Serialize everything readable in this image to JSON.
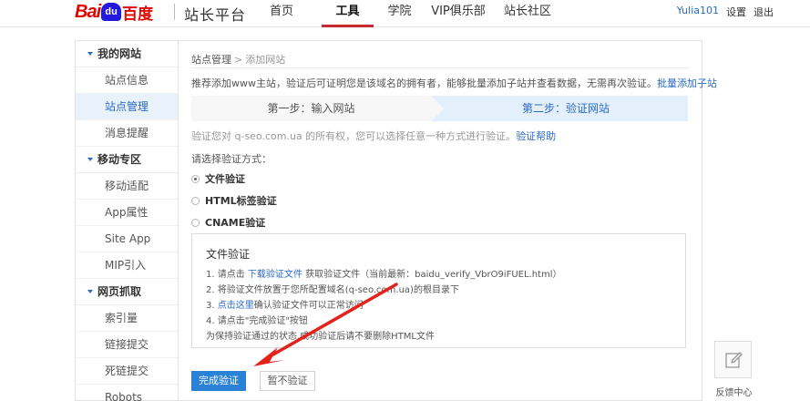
{
  "header": {
    "logo": {
      "part1": "Bai",
      "paw": "du",
      "part2": "百度"
    },
    "site_name": "站长平台",
    "nav": [
      "首页",
      "工具",
      "学院",
      "VIP俱乐部",
      "站长社区"
    ],
    "active_nav": "工具",
    "username": "Yulia101",
    "settings": "设置",
    "logout": "退出"
  },
  "sidebar": {
    "groups": [
      {
        "title": "我的网站",
        "items": [
          "站点信息",
          "站点管理",
          "消息提醒"
        ]
      },
      {
        "title": "移动专区",
        "items": [
          "移动适配",
          "App属性",
          "Site App",
          "MIP引入"
        ]
      },
      {
        "title": "网页抓取",
        "items": [
          "索引量",
          "链接提交",
          "死链提交",
          "Robots"
        ]
      }
    ],
    "active_item": "站点管理"
  },
  "main": {
    "breadcrumb": {
      "root": "站点管理",
      "sep": ">",
      "current": "添加网站"
    },
    "tip": "推荐添加www主站，验证后可证明您是该域名的拥有者，能够批量添加子站并查看数据，无需再次验证。",
    "tip_link": "批量添加子站",
    "steps": [
      "第一步：输入网站",
      "第二步：验证网站"
    ],
    "verify_info": "验证您对 q-seo.com.ua 的所有权，您可以选择任意一种方式进行验证。",
    "verify_help": "验证帮助",
    "method_label": "请选择验证方式：",
    "methods": [
      "文件验证",
      "HTML标签验证",
      "CNAME验证"
    ],
    "selected_method": "文件验证",
    "instructions": {
      "title": "文件验证",
      "step1_prefix": "1. 请点击",
      "step1_link": "下载验证文件",
      "step1_suffix": "获取验证文件（当前最新：baidu_verify_VbrO9iFUEL.html）",
      "step2": "2. 将验证文件放置于您所配置域名(q-seo.com.ua)的根目录下",
      "step3_prefix": "3.",
      "step3_link": "点击这里",
      "step3_suffix": "确认验证文件可以正常访问",
      "step4": "4. 请点击\"完成验证\"按钮",
      "note": "为保持验证通过的状态,成功验证后请不要删除HTML文件"
    },
    "complete_button": "完成验证",
    "skip_button": "暂不验证"
  },
  "feedback": {
    "label": "反馈中心",
    "icon": "edit-icon"
  },
  "colors": {
    "brand_red": "#e10602",
    "accent_blue": "#2b81d6",
    "link_blue": "#2b6ac6",
    "nav_underline": "#c8292f",
    "arrow_red": "#e3231b"
  }
}
